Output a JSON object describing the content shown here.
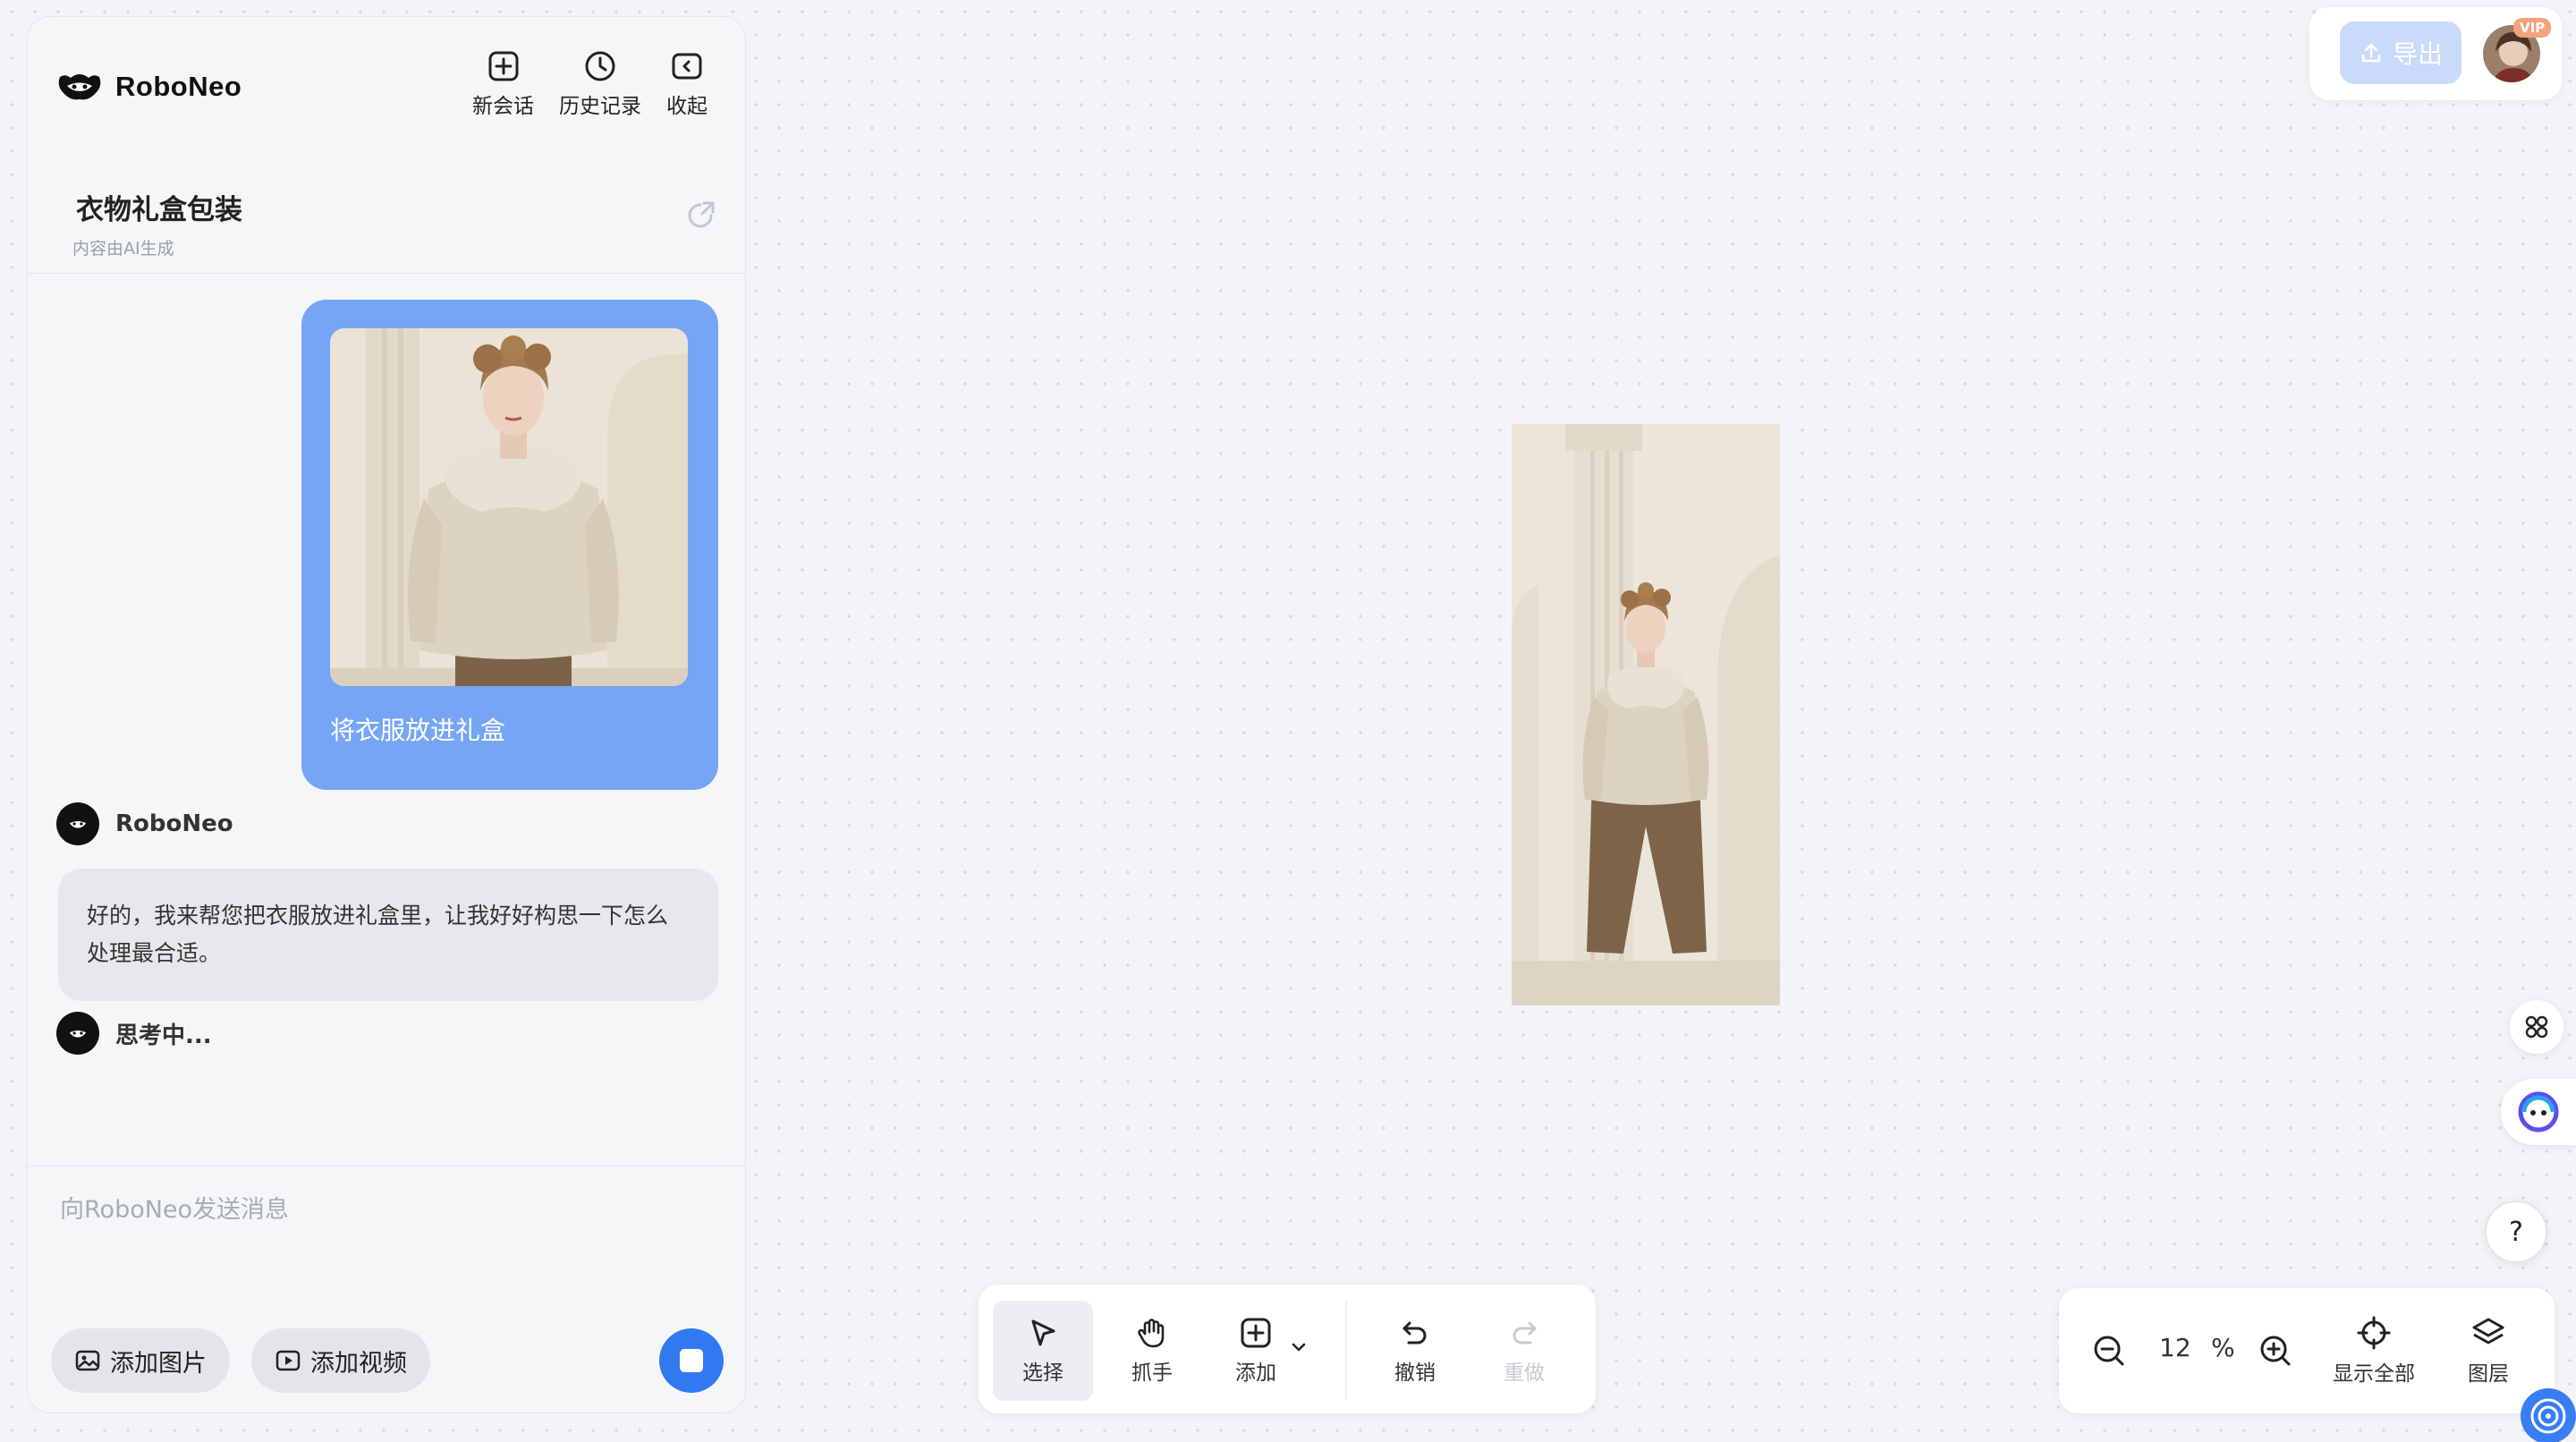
{
  "brand": {
    "name": "RoboNeo"
  },
  "top_actions": {
    "new_chat": "新会话",
    "history": "历史记录",
    "collapse": "收起"
  },
  "conversation": {
    "title": "衣物礼盒包装",
    "subtitle": "内容由AI生成"
  },
  "messages": {
    "user_text": "将衣服放进礼盒",
    "bot_name": "RoboNeo",
    "bot_reply": "好的，我来帮您把衣服放进礼盒里，让我好好构思一下怎么处理最合适。",
    "thinking": "思考中..."
  },
  "composer": {
    "placeholder": "向RoboNeo发送消息",
    "add_image": "添加图片",
    "add_video": "添加视频"
  },
  "header_right": {
    "export": "导出",
    "vip": "VIP"
  },
  "toolbar": {
    "select": "选择",
    "hand": "抓手",
    "add": "添加",
    "undo": "撤销",
    "redo": "重做"
  },
  "zoom": {
    "value": "12",
    "unit": "%",
    "fit_all": "显示全部",
    "layers": "图层"
  },
  "side_buttons": {
    "help": "?"
  },
  "colors": {
    "accent": "#3179f1",
    "user_bubble": "#77a5f5",
    "export_button": "#c9dafb"
  }
}
